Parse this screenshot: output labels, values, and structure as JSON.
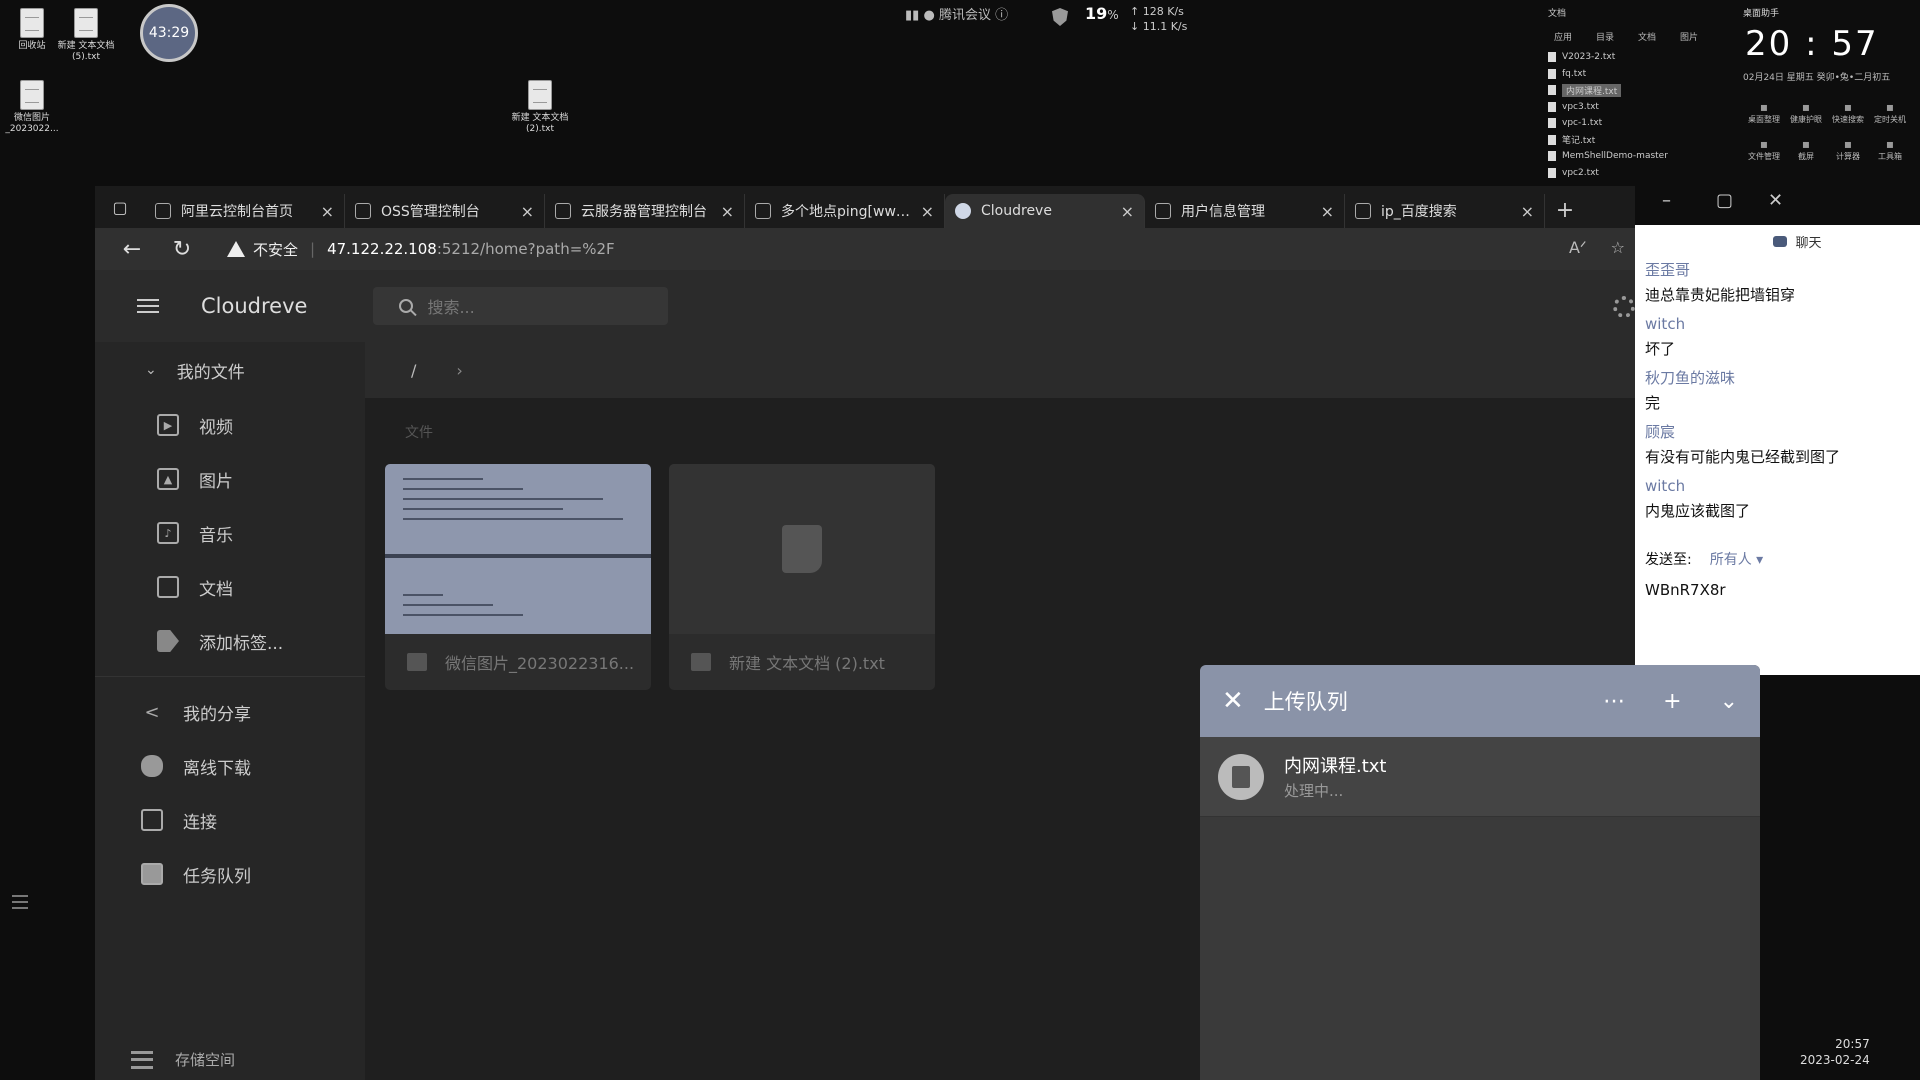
{
  "desktop": {
    "icons": [
      {
        "label": "回收站"
      },
      {
        "label": "新建 文本文档 (5).txt"
      },
      {
        "label": "微信图片_2023022..."
      },
      {
        "label": "新建 文本文档 (2).txt"
      }
    ],
    "timer": "43:29",
    "meeting_label": "腾讯会议",
    "net": {
      "percent": "19",
      "percent_unit": "%",
      "up": "128 K/s",
      "down": "11.1 K/s"
    }
  },
  "file_panel": {
    "title": "文档",
    "tabs": [
      "应用",
      "目录",
      "文档",
      "图片"
    ],
    "files": [
      "V2023-2.txt",
      "fq.txt",
      "内网课程.txt",
      "vpc3.txt",
      "vpc-1.txt",
      "笔记.txt",
      "MemShellDemo-master",
      "vpc2.txt"
    ]
  },
  "clock_panel": {
    "title": "桌面助手",
    "time": "20 : 57",
    "date": "02月24日   星期五   癸卯•兔•二月初五",
    "tools": [
      "桌面整理",
      "健康护眼",
      "快速搜索",
      "定时关机",
      "文件管理",
      "截屏",
      "计算器",
      "工具箱"
    ]
  },
  "browser": {
    "tabs": [
      {
        "label": "阿里云控制台首页"
      },
      {
        "label": "OSS管理控制台"
      },
      {
        "label": "云服务器管理控制台"
      },
      {
        "label": "多个地点ping[www.z..."
      },
      {
        "label": "Cloudreve",
        "active": true
      },
      {
        "label": "用户信息管理"
      },
      {
        "label": "ip_百度搜索"
      }
    ],
    "security": "不安全",
    "url_host": "47.122.22.108",
    "url_rest": ":5212/home?path=%2F"
  },
  "app": {
    "brand": "Cloudreve",
    "search_placeholder": "搜索...",
    "sidebar": {
      "my_files": "我的文件",
      "sub_items": [
        {
          "label": "视频",
          "icon": "video-icon"
        },
        {
          "label": "图片",
          "icon": "image-icon"
        },
        {
          "label": "音乐",
          "icon": "music-icon"
        },
        {
          "label": "文档",
          "icon": "document-icon"
        },
        {
          "label": "添加标签...",
          "icon": "tag-icon"
        }
      ],
      "top_items": [
        {
          "label": "我的分享",
          "icon": "share-icon"
        },
        {
          "label": "离线下载",
          "icon": "cloud-download-icon"
        },
        {
          "label": "连接",
          "icon": "devices-icon"
        },
        {
          "label": "任务队列",
          "icon": "clipboard-icon"
        }
      ],
      "storage": "存储空间"
    },
    "breadcrumb": "/",
    "section_label": "文件",
    "files": [
      {
        "name": "微信图片_2023022316..."
      },
      {
        "name": "新建 文本文档 (2).txt"
      }
    ]
  },
  "chat": {
    "title": "聊天",
    "messages": [
      {
        "sender": "歪歪哥",
        "text": "迪总靠贵妃能把墙钼穿"
      },
      {
        "sender": "witch",
        "text": "坏了"
      },
      {
        "sender": "秋刀鱼的滋味",
        "text": "完"
      },
      {
        "sender": "顾宸",
        "text": "有没有可能内鬼已经截到图了"
      },
      {
        "sender": "witch",
        "text": "内鬼应该截图了"
      }
    ],
    "send_to_label": "发送至:",
    "send_to_value": "所有人 ▾",
    "code": "WBnR7X8r"
  },
  "upload_queue": {
    "title": "上传队列",
    "item_name": "内网课程.txt",
    "item_status": "处理中..."
  },
  "tray": {
    "time": "20:57",
    "date": "2023-02-24"
  }
}
